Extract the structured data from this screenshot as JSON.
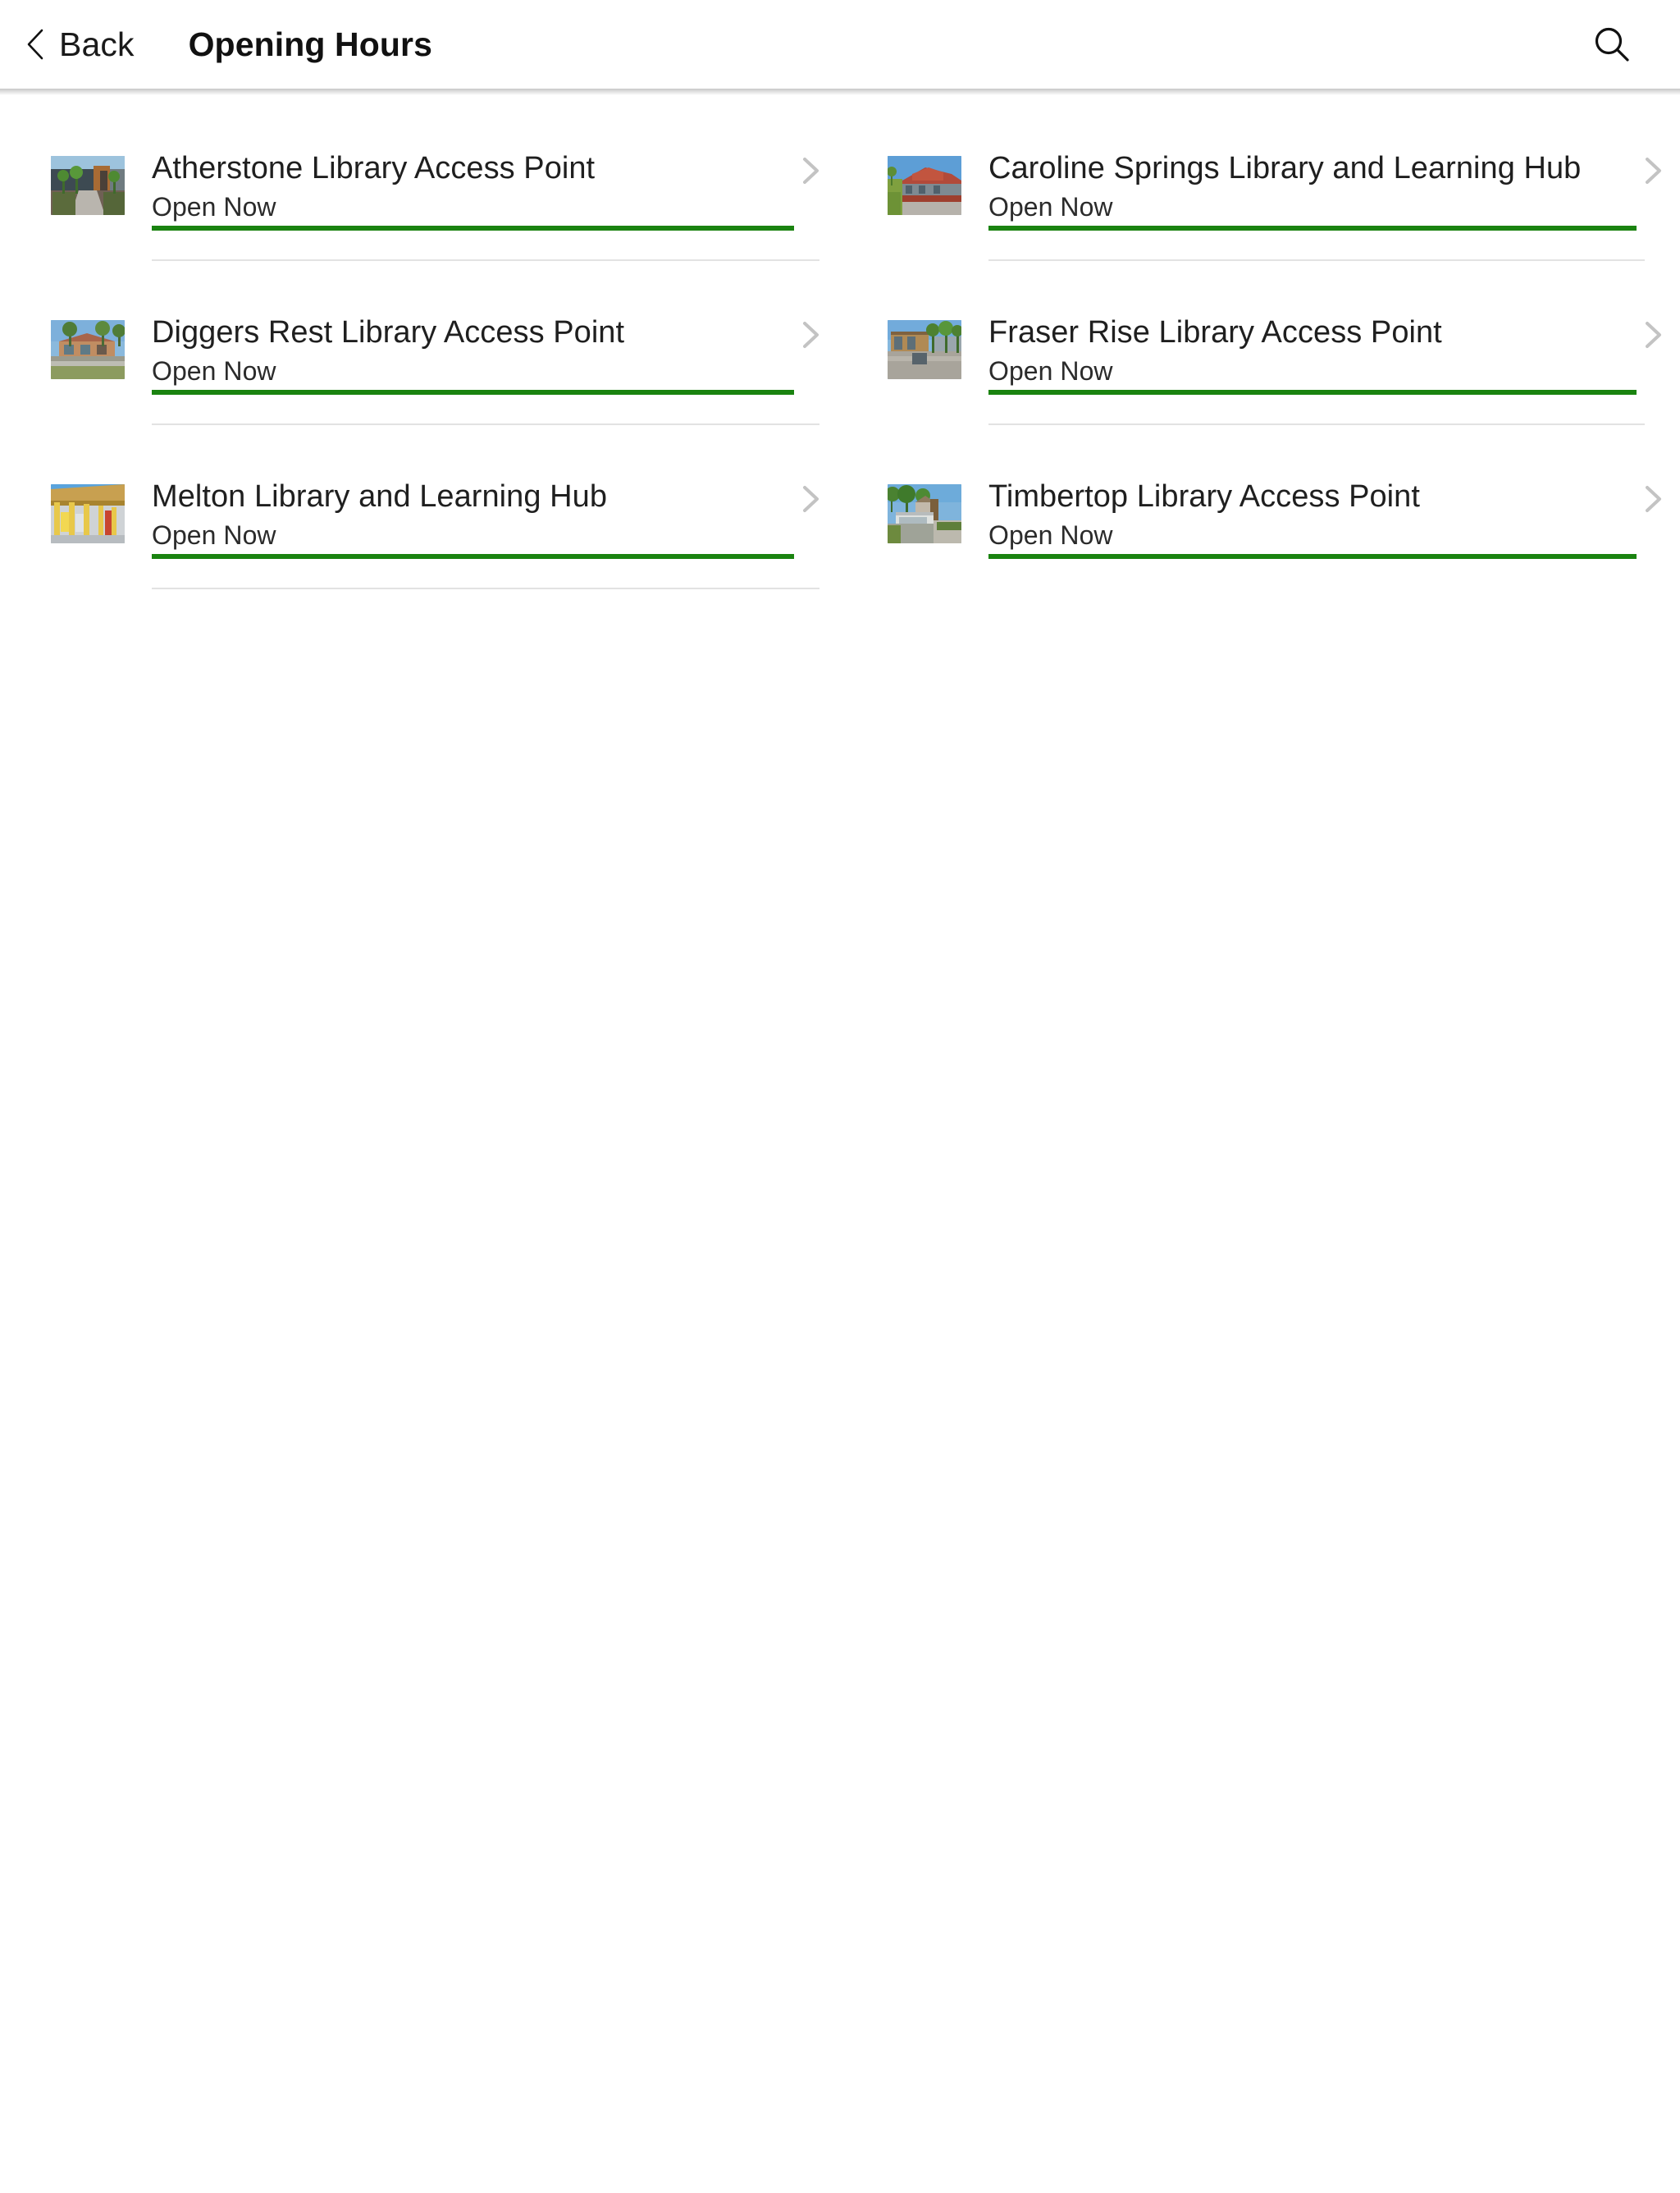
{
  "header": {
    "back_label": "Back",
    "back_icon": "chevron-left-icon",
    "title": "Opening Hours",
    "search_icon": "search-icon"
  },
  "colors": {
    "status_open": "#1a8310",
    "divider": "#e2e2e2",
    "chevron": "#c3c3c3",
    "title_text": "#1f1f1f",
    "background": "#ffffff"
  },
  "list": {
    "chevron_icon": "chevron-right-icon",
    "items": [
      {
        "title": "Atherstone Library Access Point",
        "status": "Open Now",
        "thumbnail": "library-building-photo",
        "column": "left"
      },
      {
        "title": "Caroline Springs Library and Learning Hub",
        "status": "Open Now",
        "thumbnail": "library-building-photo",
        "column": "right"
      },
      {
        "title": "Diggers Rest Library Access Point",
        "status": "Open Now",
        "thumbnail": "library-building-photo",
        "column": "left"
      },
      {
        "title": "Fraser Rise Library Access Point",
        "status": "Open Now",
        "thumbnail": "library-building-photo",
        "column": "right"
      },
      {
        "title": "Melton Library and Learning Hub",
        "status": "Open Now",
        "thumbnail": "library-building-photo",
        "column": "left"
      },
      {
        "title": "Timbertop Library Access Point",
        "status": "Open Now",
        "thumbnail": "library-building-photo",
        "column": "right"
      }
    ]
  }
}
